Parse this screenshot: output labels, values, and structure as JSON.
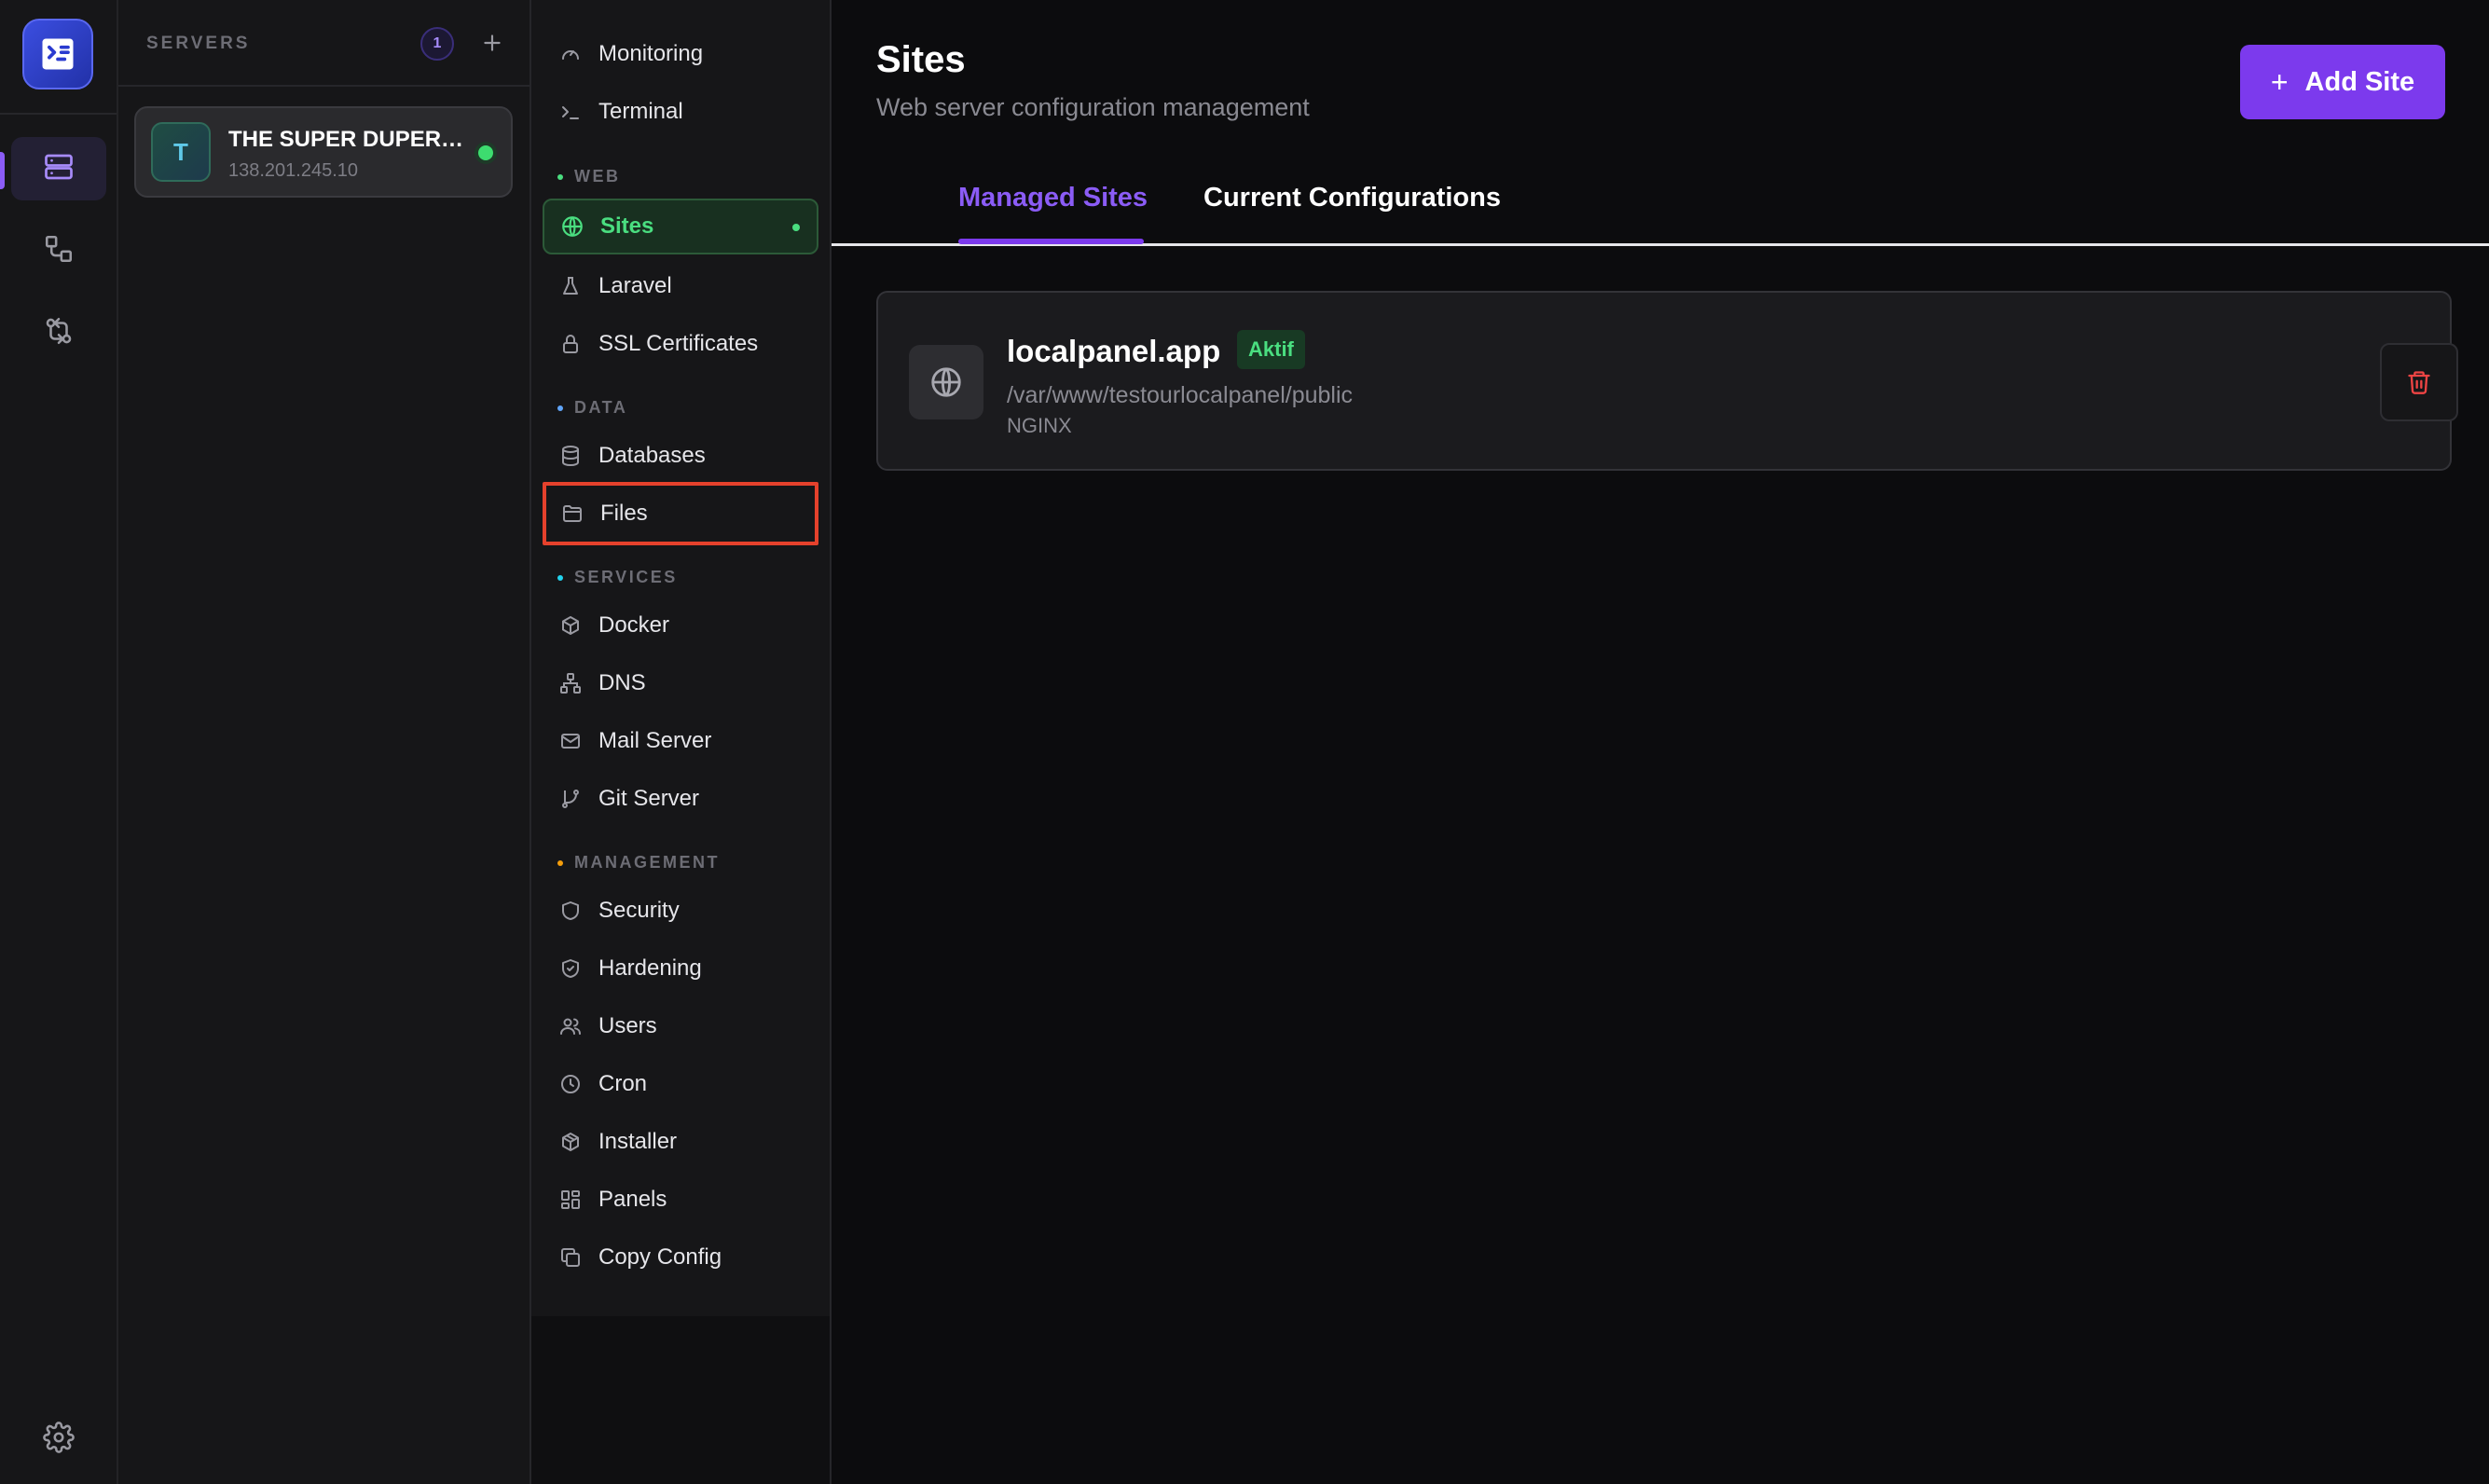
{
  "rail": {
    "icons": [
      "app-logo",
      "servers-icon",
      "deploy-flow-icon",
      "git-compare-icon",
      "settings-icon"
    ]
  },
  "servers": {
    "title": "SERVERS",
    "count": "1",
    "add_icon": "plus-icon",
    "items": [
      {
        "initial": "T",
        "name": "THE SUPER DUPER SERVER",
        "ip": "138.201.245.10",
        "status": "online"
      }
    ]
  },
  "nav": {
    "items_top": [
      {
        "label": "Monitoring",
        "icon": "gauge-icon"
      },
      {
        "label": "Terminal",
        "icon": "terminal-icon"
      }
    ],
    "sections": [
      {
        "title": "WEB",
        "color": "#4ade80",
        "items": [
          {
            "label": "Sites",
            "icon": "globe-icon",
            "active": true
          },
          {
            "label": "Laravel",
            "icon": "flask-icon"
          },
          {
            "label": "SSL Certificates",
            "icon": "lock-icon"
          }
        ]
      },
      {
        "title": "DATA",
        "color": "#60a5fa",
        "items": [
          {
            "label": "Databases",
            "icon": "database-icon"
          },
          {
            "label": "Files",
            "icon": "folder-icon",
            "highlighted": true
          }
        ]
      },
      {
        "title": "SERVICES",
        "color": "#22d3ee",
        "items": [
          {
            "label": "Docker",
            "icon": "box-icon"
          },
          {
            "label": "DNS",
            "icon": "network-icon"
          },
          {
            "label": "Mail Server",
            "icon": "mail-icon"
          },
          {
            "label": "Git Server",
            "icon": "git-branch-icon"
          }
        ]
      },
      {
        "title": "MANAGEMENT",
        "color": "#f59e0b",
        "items": [
          {
            "label": "Security",
            "icon": "shield-icon"
          },
          {
            "label": "Hardening",
            "icon": "shield-check-icon"
          },
          {
            "label": "Users",
            "icon": "users-icon"
          },
          {
            "label": "Cron",
            "icon": "clock-icon"
          },
          {
            "label": "Installer",
            "icon": "package-icon"
          },
          {
            "label": "Panels",
            "icon": "grid-icon"
          },
          {
            "label": "Copy Config",
            "icon": "copy-icon"
          }
        ]
      }
    ]
  },
  "main": {
    "title": "Sites",
    "subtitle": "Web server configuration management",
    "add_button": "Add Site",
    "tabs": [
      {
        "label": "Managed Sites",
        "active": true
      },
      {
        "label": "Current Configurations",
        "active": false
      }
    ],
    "sites": [
      {
        "domain": "localpanel.app",
        "status": "Aktif",
        "path": "/var/www/testourlocalpanel/public",
        "server": "NGINX"
      }
    ]
  },
  "colors": {
    "accent": "#7c3aed",
    "active_green": "#4ade80",
    "highlight_red": "#e5412c"
  }
}
